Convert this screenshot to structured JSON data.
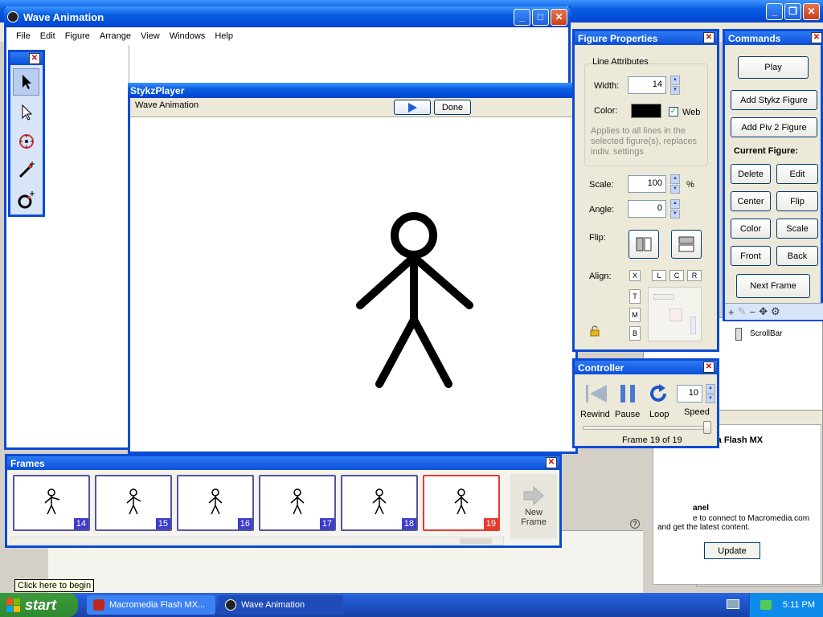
{
  "main_window": {
    "title": "Wave Animation",
    "menu": [
      "File",
      "Edit",
      "Figure",
      "Arrange",
      "View",
      "Windows",
      "Help"
    ]
  },
  "player": {
    "title": "StykzPlayer",
    "project": "Wave Animation",
    "done_label": "Done"
  },
  "figure_properties": {
    "title": "Figure Properties",
    "line_attributes_label": "Line Attributes",
    "width_label": "Width:",
    "width_value": "14",
    "color_label": "Color:",
    "color_value": "#000000",
    "web_label": "Web",
    "note": "Applies to all lines in the selected figure(s), replaces indiv. settings",
    "scale_label": "Scale:",
    "scale_value": "100",
    "percent": "%",
    "angle_label": "Angle:",
    "angle_value": "0",
    "flip_label": "Flip:",
    "align_label": "Align:",
    "align_h": [
      "X",
      "L",
      "C",
      "R"
    ],
    "align_v": [
      "T",
      "M",
      "B"
    ]
  },
  "commands": {
    "title": "Commands",
    "play": "Play",
    "add_stykz": "Add Stykz Figure",
    "add_piv": "Add Piv 2 Figure",
    "current_figure": "Current Figure:",
    "delete": "Delete",
    "edit": "Edit",
    "center": "Center",
    "flip": "Flip",
    "color": "Color",
    "scale": "Scale",
    "front": "Front",
    "back": "Back",
    "next_frame": "Next Frame"
  },
  "controller": {
    "title": "Controller",
    "rewind": "Rewind",
    "pause": "Pause",
    "loop": "Loop",
    "speed_label": "Speed",
    "speed_value": "10",
    "frame_status": "Frame 19 of 19",
    "position": 1.0
  },
  "frames_panel": {
    "title": "Frames",
    "frames": [
      {
        "num": "14"
      },
      {
        "num": "15"
      },
      {
        "num": "16"
      },
      {
        "num": "17"
      },
      {
        "num": "18"
      },
      {
        "num": "19"
      }
    ],
    "new_frame": "New Frame"
  },
  "background": {
    "scrollbar": "ScrollBar",
    "flash_heading": "media Flash MX",
    "panel_heading": "anel",
    "panel_text": "e to connect to Macromedia.com and get the latest content.",
    "update": "Update"
  },
  "tooltip": "Click here to begin",
  "taskbar": {
    "start": "start",
    "tasks": [
      "Macromedia Flash MX...",
      "Wave Animation"
    ],
    "clock": "5:11 PM"
  }
}
